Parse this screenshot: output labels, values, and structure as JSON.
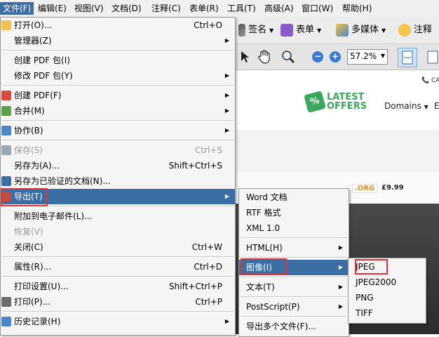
{
  "menubar": [
    "文件(F)",
    "编辑(E)",
    "视图(V)",
    "文档(D)",
    "注释(C)",
    "表单(R)",
    "工具(T)",
    "高级(A)",
    "窗口(W)",
    "帮助(H)"
  ],
  "toolbar": {
    "sign": "签名",
    "form": "表单",
    "multimedia": "多媒体",
    "comment": "注释",
    "zoom": "57.2%"
  },
  "webpage": {
    "logo_line1": "LATEST",
    "logo_line2": "OFFERS",
    "nav_domains": "Domains",
    "top_right": "CA",
    "price": "£9.99",
    "tld": ".ORG",
    "edge_e": "E"
  },
  "file_menu": [
    {
      "label": "打开(O)...",
      "shortcut": "Ctrl+O",
      "icon": "open-folder-icon"
    },
    {
      "label": "管理器(Z)",
      "arrow": true
    },
    {
      "sep": true
    },
    {
      "label": "创建 PDF 包(I)"
    },
    {
      "label": "修改 PDF 包(Y)",
      "arrow": true
    },
    {
      "sep": true
    },
    {
      "label": "创建 PDF(F)",
      "arrow": true,
      "icon": "create-pdf-icon"
    },
    {
      "label": "合并(M)",
      "arrow": true,
      "icon": "merge-icon"
    },
    {
      "sep": true
    },
    {
      "label": "协作(B)",
      "arrow": true,
      "icon": "collaborate-icon"
    },
    {
      "sep": true
    },
    {
      "label": "保存(S)",
      "shortcut": "Ctrl+S",
      "disabled": true,
      "icon": "save-icon"
    },
    {
      "label": "另存为(A)...",
      "shortcut": "Shift+Ctrl+S"
    },
    {
      "label": "另存为已验证的文档(N)...",
      "icon": "certified-doc-icon"
    },
    {
      "label": "导出(T)",
      "arrow": true,
      "highlight": true,
      "icon": "export-icon"
    },
    {
      "sep": true
    },
    {
      "label": "附加到电子邮件(L)..."
    },
    {
      "label": "恢复(V)",
      "disabled": true
    },
    {
      "label": "关闭(C)",
      "shortcut": "Ctrl+W"
    },
    {
      "sep": true
    },
    {
      "label": "属性(R)...",
      "shortcut": "Ctrl+D"
    },
    {
      "sep": true
    },
    {
      "label": "打印设置(U)...",
      "shortcut": "Shift+Ctrl+P"
    },
    {
      "label": "打印(P)...",
      "shortcut": "Ctrl+P",
      "icon": "print-icon"
    },
    {
      "sep": true
    },
    {
      "label": "历史记录(H)",
      "arrow": true,
      "icon": "history-icon"
    }
  ],
  "export_menu": [
    {
      "label": "Word 文档"
    },
    {
      "label": "RTF 格式"
    },
    {
      "label": "XML 1.0"
    },
    {
      "sep": true
    },
    {
      "label": "HTML(H)",
      "arrow": true
    },
    {
      "sep": true
    },
    {
      "label": "图像(I)",
      "arrow": true,
      "highlight": true
    },
    {
      "sep": true
    },
    {
      "label": "文本(T)",
      "arrow": true
    },
    {
      "sep": true
    },
    {
      "label": "PostScript(P)",
      "arrow": true
    },
    {
      "sep": true
    },
    {
      "label": "导出多个文件(F)..."
    }
  ],
  "image_menu": [
    {
      "label": "JPEG"
    },
    {
      "label": "JPEG2000"
    },
    {
      "label": "PNG"
    },
    {
      "label": "TIFF"
    }
  ],
  "colors": {
    "highlight": "#3a6ea5",
    "annotation": "#e53333",
    "logo_green": "#3aa85c"
  }
}
